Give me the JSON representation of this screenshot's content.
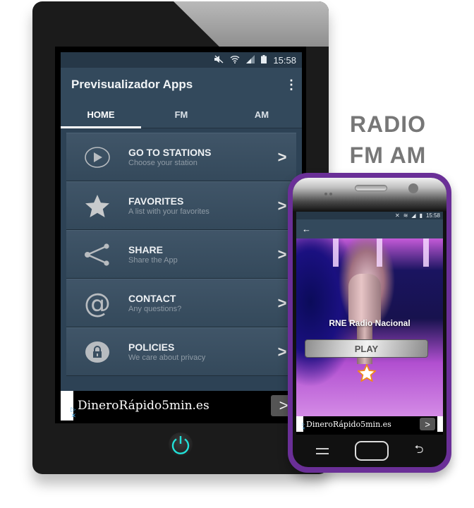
{
  "tablet": {
    "status_bar": {
      "time": "15:58",
      "icons": [
        "mute-icon",
        "wifi-icon",
        "signal-icon",
        "battery-icon"
      ]
    },
    "app_title": "Previsualizador Apps",
    "overflow_icon": "⋮",
    "tabs": [
      {
        "label": "HOME",
        "active": true
      },
      {
        "label": "FM",
        "active": false
      },
      {
        "label": "AM",
        "active": false
      }
    ],
    "menu_items": [
      {
        "title": "GO TO STATIONS",
        "subtitle": "Choose your station",
        "icon": "play-circle-icon"
      },
      {
        "title": "FAVORITES",
        "subtitle": "A list with your favorites",
        "icon": "star-icon"
      },
      {
        "title": "SHARE",
        "subtitle": "Share the App",
        "icon": "share-icon"
      },
      {
        "title": "CONTACT",
        "subtitle": "Any questions?",
        "icon": "at-icon"
      },
      {
        "title": "POLICIES",
        "subtitle": "We care about privacy",
        "icon": "lock-icon"
      }
    ],
    "chevron": ">",
    "ad": {
      "text": "DineroRápido5min.es",
      "button": ">"
    }
  },
  "heading": {
    "line1": "RADIO",
    "line2": "FM AM"
  },
  "phone": {
    "status_bar": {
      "time": "15:58"
    },
    "back_icon": "←",
    "station_name": "RNE Radio Nacional",
    "play_label": "PLAY",
    "ad": {
      "text": "DineroRápido5min.es",
      "button": ">"
    },
    "nav_back_icon": "⮌"
  },
  "colors": {
    "appbar": "#33495c",
    "statusbar": "#263848",
    "phone_frame": "#6a2f97",
    "power_accent": "#22e0d8",
    "favorite_star": "#f08a1c"
  }
}
